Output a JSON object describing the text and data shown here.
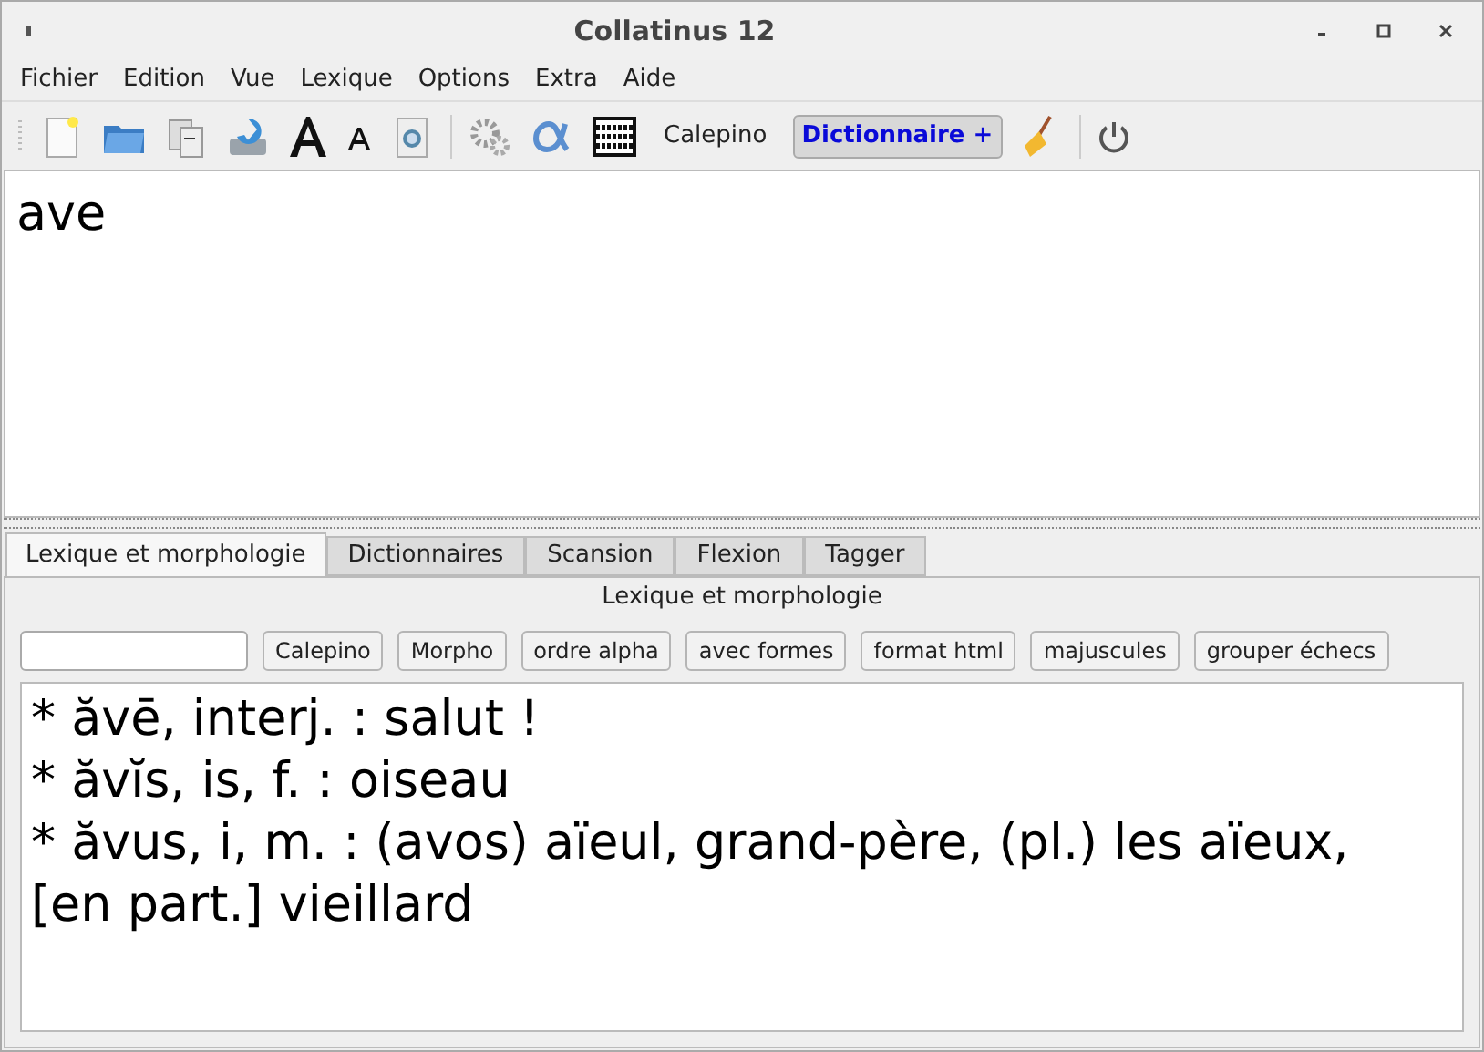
{
  "window": {
    "title": "Collatinus 12"
  },
  "menu": [
    "Fichier",
    "Edition",
    "Vue",
    "Lexique",
    "Options",
    "Extra",
    "Aide"
  ],
  "toolbar": {
    "calepino": "Calepino",
    "dictionnaire": {
      "label": "Dictionnaire +",
      "checked": true
    }
  },
  "editor": {
    "value": "ave"
  },
  "tabs": [
    {
      "label": "Lexique et morphologie",
      "selected": true
    },
    {
      "label": "Dictionnaires",
      "selected": false
    },
    {
      "label": "Scansion",
      "selected": false
    },
    {
      "label": "Flexion",
      "selected": false
    },
    {
      "label": "Tagger",
      "selected": false
    }
  ],
  "dock": {
    "title": "Lexique et morphologie",
    "buttons": [
      "Calepino",
      "Morpho",
      "ordre alpha",
      "avec formes",
      "format html",
      "majuscules",
      "grouper échecs"
    ]
  },
  "results": [
    "* ăvē, interj. : salut !",
    "* ăvĭs, is, f. : oiseau",
    "* ăvus, i, m. : (avos) aïeul, grand-père, (pl.) les aïeux, [en part.] vieillard"
  ]
}
